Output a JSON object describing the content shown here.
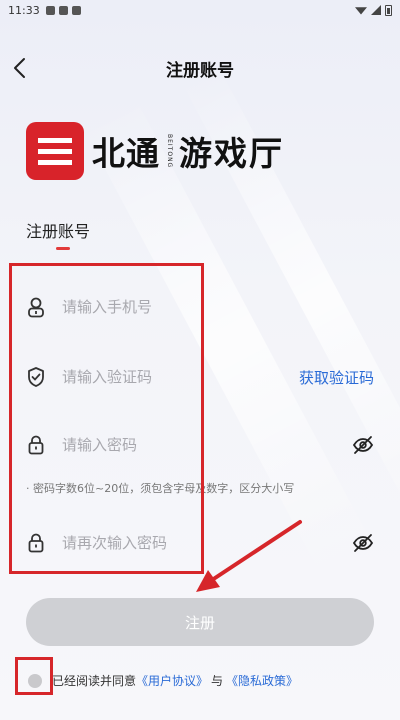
{
  "status_bar": {
    "time": "11:33"
  },
  "nav": {
    "title": "注册账号",
    "back_icon": "chevron-left-icon"
  },
  "logo": {
    "brand": "北通",
    "brand_en": "BEITONG",
    "sub": "游戏厅",
    "mark_color": "#d8232a"
  },
  "form": {
    "section_title": "注册账号",
    "phone": {
      "placeholder": "请输入手机号",
      "value": "",
      "icon": "user-icon"
    },
    "code": {
      "placeholder": "请输入验证码",
      "value": "",
      "icon": "shield-icon",
      "action_label": "获取验证码"
    },
    "password": {
      "placeholder": "请输入密码",
      "value": "",
      "icon": "lock-icon",
      "toggle_icon": "eye-off-icon"
    },
    "password_hint": "· 密码字数6位~20位，须包含字母及数字，区分大小写",
    "confirm": {
      "placeholder": "请再次输入密码",
      "value": "",
      "icon": "lock-icon",
      "toggle_icon": "eye-off-icon"
    },
    "submit_label": "注册"
  },
  "agreement": {
    "prefix": "已经阅读并同意",
    "user_agreement": "《用户协议》",
    "conjunction": "与",
    "privacy_policy": "《隐私政策》"
  },
  "colors": {
    "accent": "#2a6bd6",
    "annotation": "#d6262a",
    "disabled_button": "#cfd0d4"
  }
}
